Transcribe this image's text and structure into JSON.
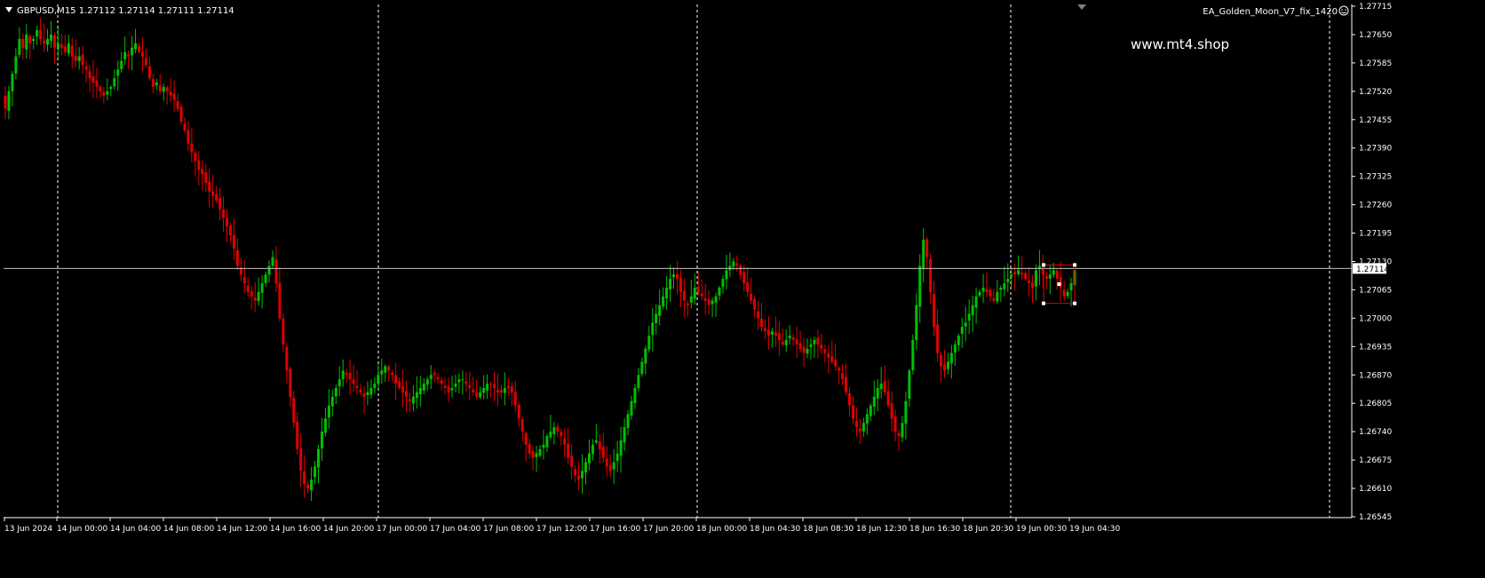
{
  "header": {
    "symbol_line": "GBPUSD,M15  1.27112 1.27114 1.27111 1.27114",
    "ea_name": "EA_Golden_Moon_V7_fix_1420",
    "ea_icon": "smiley-icon",
    "watermark": "www.mt4.shop"
  },
  "colors": {
    "background": "#000000",
    "grid": "#ffffff",
    "bull": "#00c000",
    "bear": "#e00000",
    "bid_line": "#c0c0c0",
    "box": "#e00000"
  },
  "chart_data": {
    "type": "candlestick",
    "symbol": "GBPUSD",
    "timeframe": "M15",
    "last_price": "1.27114",
    "ylim": [
      1.26545,
      1.27715
    ],
    "y_ticks": [
      "1.27715",
      "1.27650",
      "1.27585",
      "1.27520",
      "1.27455",
      "1.27390",
      "1.27325",
      "1.27260",
      "1.27195",
      "1.27130",
      "1.27065",
      "1.27000",
      "1.26935",
      "1.26870",
      "1.26805",
      "1.26740",
      "1.26675",
      "1.26610",
      "1.26545"
    ],
    "x_ticks": [
      "13 Jun 2024",
      "14 Jun 00:00",
      "14 Jun 04:00",
      "14 Jun 08:00",
      "14 Jun 12:00",
      "14 Jun 16:00",
      "14 Jun 20:00",
      "17 Jun 00:00",
      "17 Jun 04:00",
      "17 Jun 08:00",
      "17 Jun 12:00",
      "17 Jun 16:00",
      "17 Jun 20:00",
      "18 Jun 00:00",
      "18 Jun 04:30",
      "18 Jun 08:30",
      "18 Jun 12:30",
      "18 Jun 16:30",
      "18 Jun 20:30",
      "19 Jun 00:30",
      "19 Jun 04:30"
    ],
    "day_separators": [
      "14 Jun 00:00",
      "17 Jun 00:00",
      "18 Jun 00:00",
      "19 Jun 00:00"
    ],
    "grid": "vertical dotted day separators",
    "closes": [
      1.2748,
      1.2752,
      1.2756,
      1.276,
      1.2764,
      1.2762,
      1.2765,
      1.2763,
      1.2764,
      1.2766,
      1.2764,
      1.2763,
      1.2764,
      1.2765,
      1.2762,
      1.2763,
      1.2762,
      1.2761,
      1.2763,
      1.276,
      1.2759,
      1.276,
      1.2758,
      1.2757,
      1.2755,
      1.2754,
      1.2753,
      1.2752,
      1.2751,
      1.2752,
      1.2753,
      1.2755,
      1.2757,
      1.2759,
      1.2761,
      1.276,
      1.2762,
      1.2763,
      1.2761,
      1.276,
      1.2758,
      1.2755,
      1.2753,
      1.2754,
      1.2752,
      1.2753,
      1.2752,
      1.2751,
      1.275,
      1.2748,
      1.2745,
      1.2743,
      1.274,
      1.2738,
      1.2736,
      1.2734,
      1.2733,
      1.2731,
      1.2729,
      1.2728,
      1.2727,
      1.2725,
      1.2723,
      1.2721,
      1.2719,
      1.2716,
      1.2712,
      1.271,
      1.2708,
      1.2706,
      1.2705,
      1.2704,
      1.2706,
      1.2708,
      1.271,
      1.2712,
      1.2714,
      1.2708,
      1.27,
      1.2694,
      1.2688,
      1.2682,
      1.2676,
      1.267,
      1.2665,
      1.2662,
      1.2661,
      1.2663,
      1.2666,
      1.267,
      1.2674,
      1.2677,
      1.268,
      1.2682,
      1.2684,
      1.2686,
      1.2688,
      1.2687,
      1.2686,
      1.2685,
      1.2684,
      1.2683,
      1.2682,
      1.2683,
      1.2684,
      1.2685,
      1.2687,
      1.2688,
      1.2689,
      1.2688,
      1.2687,
      1.2685,
      1.2684,
      1.2683,
      1.2682,
      1.2681,
      1.2682,
      1.2683,
      1.2684,
      1.2685,
      1.2686,
      1.2687,
      1.2687,
      1.2686,
      1.2685,
      1.2684,
      1.2683,
      1.2684,
      1.2685,
      1.2686,
      1.2686,
      1.2685,
      1.2684,
      1.2683,
      1.2682,
      1.2683,
      1.2684,
      1.2685,
      1.2685,
      1.2684,
      1.2683,
      1.2683,
      1.2684,
      1.2684,
      1.2683,
      1.268,
      1.2677,
      1.2674,
      1.2671,
      1.2669,
      1.2668,
      1.2669,
      1.267,
      1.2671,
      1.2673,
      1.2674,
      1.2675,
      1.2674,
      1.2673,
      1.2671,
      1.2668,
      1.2666,
      1.2664,
      1.2663,
      1.2665,
      1.2667,
      1.2669,
      1.2671,
      1.2672,
      1.267,
      1.2668,
      1.2666,
      1.2665,
      1.2667,
      1.2669,
      1.2672,
      1.2675,
      1.2678,
      1.2681,
      1.2684,
      1.2687,
      1.269,
      1.2693,
      1.2696,
      1.2699,
      1.2701,
      1.2703,
      1.2705,
      1.2707,
      1.2709,
      1.271,
      1.2709,
      1.2706,
      1.2704,
      1.2703,
      1.2705,
      1.2707,
      1.2706,
      1.2705,
      1.2704,
      1.2703,
      1.2704,
      1.2705,
      1.2707,
      1.2709,
      1.2711,
      1.2712,
      1.2713,
      1.2712,
      1.271,
      1.2708,
      1.2706,
      1.2704,
      1.2702,
      1.27,
      1.2698,
      1.2697,
      1.2696,
      1.2697,
      1.2696,
      1.2695,
      1.2694,
      1.2695,
      1.2696,
      1.2695,
      1.2694,
      1.2693,
      1.2692,
      1.2693,
      1.2694,
      1.2695,
      1.2694,
      1.2693,
      1.2692,
      1.2691,
      1.269,
      1.2689,
      1.2688,
      1.2686,
      1.2683,
      1.268,
      1.2677,
      1.2675,
      1.2674,
      1.2676,
      1.2678,
      1.268,
      1.2682,
      1.2684,
      1.2685,
      1.2683,
      1.268,
      1.2677,
      1.2674,
      1.2673,
      1.2676,
      1.2681,
      1.2688,
      1.2695,
      1.2703,
      1.2712,
      1.2718,
      1.2714,
      1.2706,
      1.2698,
      1.2692,
      1.2689,
      1.2688,
      1.269,
      1.2692,
      1.2694,
      1.2696,
      1.2698,
      1.2699,
      1.2701,
      1.2703,
      1.2705,
      1.2706,
      1.2707,
      1.2706,
      1.2705,
      1.2704,
      1.2706,
      1.2707,
      1.2708,
      1.2709,
      1.271,
      1.271,
      1.2711,
      1.271,
      1.2709,
      1.2708,
      1.2707,
      1.2711,
      1.2712,
      1.271,
      1.2709,
      1.271,
      1.2711,
      1.2709,
      1.2707,
      1.2705,
      1.2706,
      1.2708,
      1.2711
    ]
  }
}
